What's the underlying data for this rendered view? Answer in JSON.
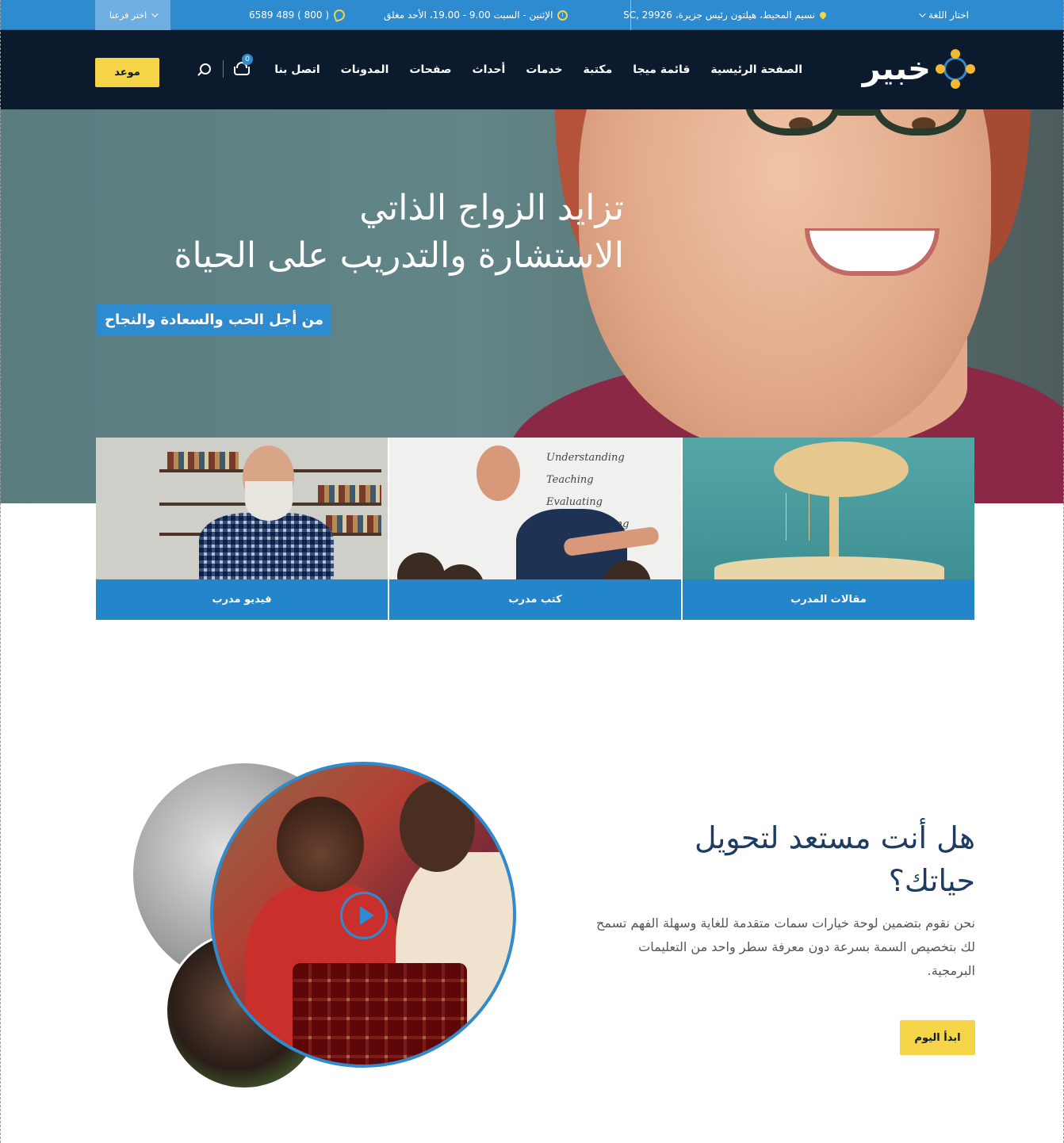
{
  "topbar": {
    "language_label": "اختار اللغة",
    "address": "نسيم المحيط، هيلتون رئيس جزيرة، SC, 29926",
    "hours": "الإثنين - السبت 9.00 - 19.00، الأحد مغلق",
    "phone": "( 800 ) 489 6589",
    "branch_label": "اختر فرعنا"
  },
  "header": {
    "logo_text": "خبير",
    "nav": [
      "الصفحة الرئيسية",
      "قائمة ميجا",
      "مكتبة",
      "خدمات",
      "أحداث",
      "صفحات",
      "المدونات",
      "اتصل بنا"
    ],
    "cart_count": "0",
    "appointment_button": "موعد"
  },
  "hero": {
    "title_line1": "تزايد الزواج الذاتي",
    "title_line2": "الاستشارة والتدريب على الحياة",
    "badge": "من أجل الحب والسعادة والنجاح"
  },
  "cards": [
    {
      "label": "مقالات المدرب"
    },
    {
      "label": "كتب مدرب",
      "board_lines": [
        "Understanding",
        "Teaching",
        "Evaluating",
        "Communicating"
      ]
    },
    {
      "label": "فيديو مدرب"
    }
  ],
  "about": {
    "title": "هل أنت مستعد لتحويل حياتك؟",
    "text": "نحن نقوم بتضمين لوحة خيارات سمات متقدمة للغاية وسهلة الفهم تسمح لك بتخصيص السمة بسرعة دون معرفة سطر واحد من التعليمات البرمجية.",
    "button": "ابدأ اليوم"
  },
  "colors": {
    "topbar": "#2f8bcf",
    "header": "#0b1a2c",
    "accent_yellow": "#f5d547",
    "card_label": "#2386cb",
    "title_navy": "#1d3b63"
  }
}
